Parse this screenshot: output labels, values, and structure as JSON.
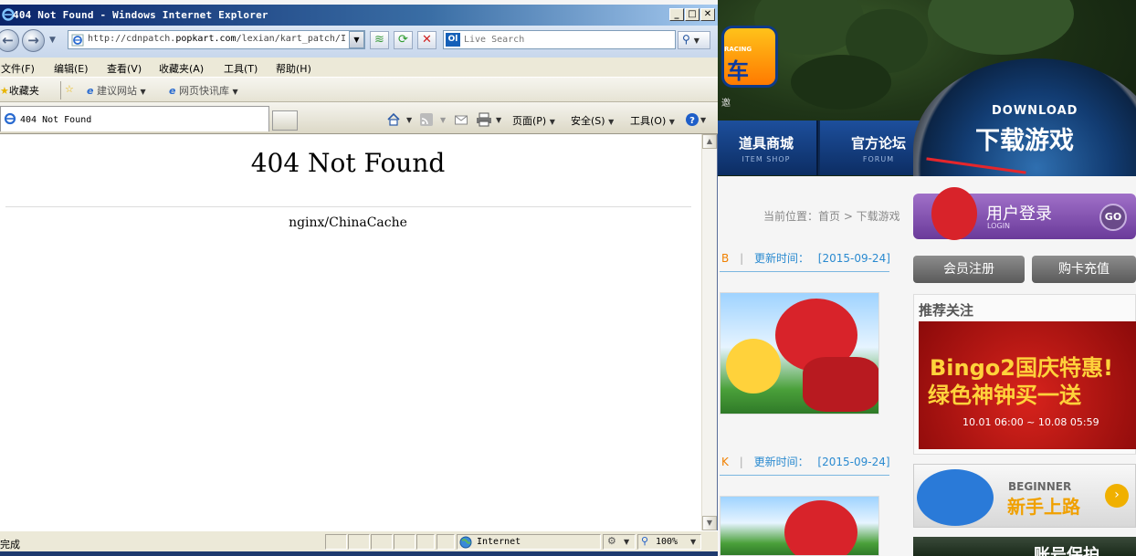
{
  "window": {
    "title": "404 Not Found - Windows Internet Explorer",
    "minimize": "_",
    "maximize": "□",
    "close": "✕"
  },
  "address_bar": {
    "url_prefix": "http://cdnpatch.",
    "url_domain": "popkart.com",
    "url_path": "/lexian/kart_patch/I",
    "search_placeholder": "Live Search",
    "search_logo": "Ol"
  },
  "menu": [
    "文件(F)",
    "编辑(E)",
    "查看(V)",
    "收藏夹(A)",
    "工具(T)",
    "帮助(H)"
  ],
  "favorites_bar": {
    "favorites": "收藏夹",
    "suggested_sites": "建议网站",
    "web_slice_gallery": "网页快讯库"
  },
  "tab": {
    "title": "404 Not Found"
  },
  "command_bar": {
    "page": "页面(P)",
    "safety": "安全(S)",
    "tools": "工具(O)"
  },
  "page": {
    "heading": "404 Not Found",
    "server": "nginx/ChinaCache"
  },
  "status_bar": {
    "status": "完成",
    "zone": "Internet",
    "zoom": "100%"
  },
  "background_site": {
    "nav_items": [
      {
        "label": "道具商城",
        "sub": "ITEM SHOP"
      },
      {
        "label": "官方论坛",
        "sub": "FORUM"
      }
    ],
    "logo_text": "车",
    "logo_small": "RACING",
    "logo_sub": "邀",
    "download_en": "DOWNLOAD",
    "download_cn": "下载游戏",
    "breadcrumb": "当前位置：首页 > 下载游戏",
    "items": [
      {
        "prefix": "B",
        "update_label": "更新时间：",
        "date": "[2015-09-24]"
      },
      {
        "prefix": "K",
        "update_label": "更新时间：",
        "date": "[2015-09-24]"
      }
    ],
    "login": {
      "title": "用户登录",
      "sub": "LOGIN",
      "go": "GO"
    },
    "register": "会员注册",
    "card_recharge": "购卡充值",
    "recommend_title": "推荐关注",
    "promo_line1": "Bingo2国庆特惠!",
    "promo_line2": "绿色神钟买一送",
    "promo_dates": "10.01 06:00 ~ 10.08 05:59",
    "beginner_en": "BEGINNER",
    "beginner_cn": "新手上路",
    "bottom_text": "账号保护"
  },
  "colors": {
    "title_bar_start": "#0a246a",
    "title_bar_end": "#a6caf0",
    "chrome": "#ece9d8",
    "link_blue": "#2a8ad0"
  }
}
